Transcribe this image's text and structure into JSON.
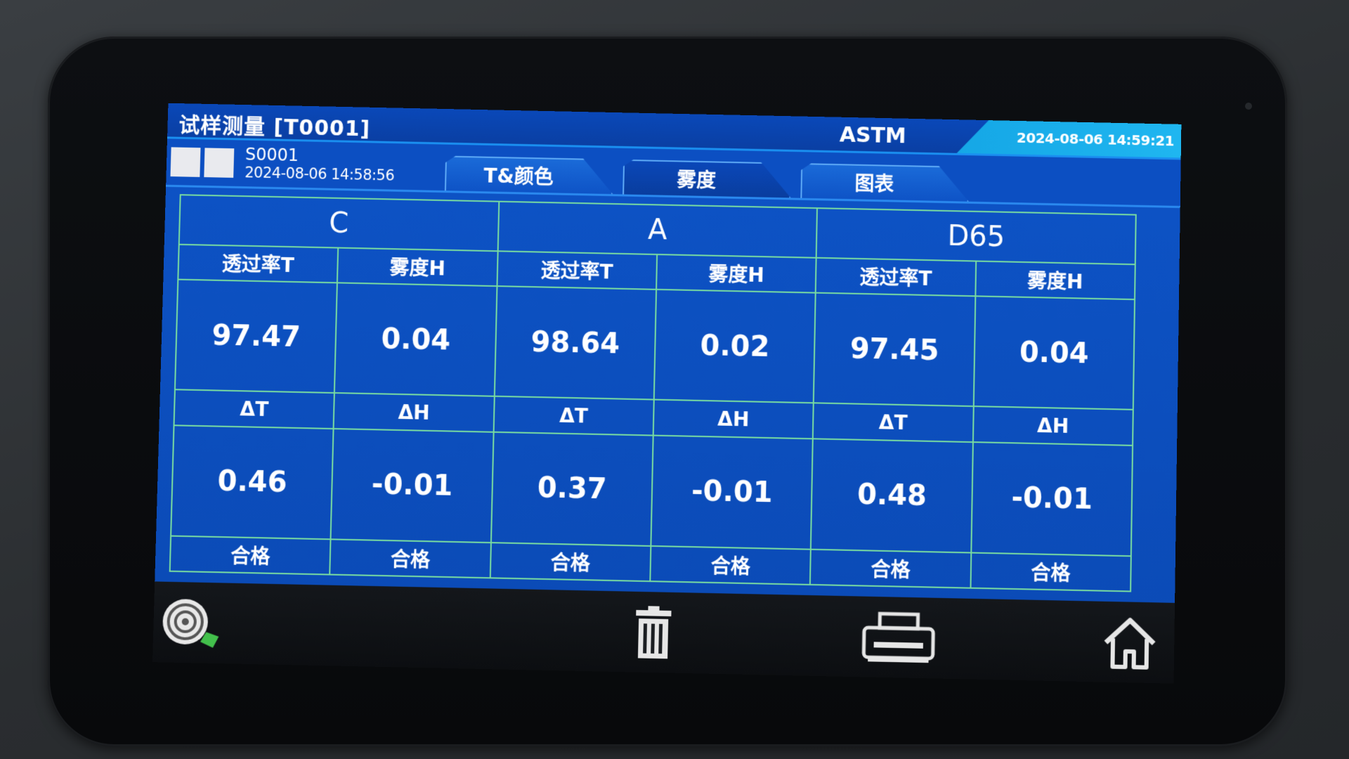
{
  "header": {
    "title": "试样测量 [T0001]",
    "standard": "ASTM",
    "datetime": "2024-08-06 14:59:21"
  },
  "sample": {
    "id": "S0001",
    "time": "2024-08-06 14:58:56"
  },
  "tabs": [
    {
      "label": "T&颜色",
      "active": false
    },
    {
      "label": "雾度",
      "active": true
    },
    {
      "label": "图表",
      "active": false
    }
  ],
  "results": {
    "illuminants": [
      "C",
      "A",
      "D65"
    ],
    "quantity_headers": [
      "透过率T",
      "雾度H"
    ],
    "delta_headers": [
      "ΔT",
      "ΔH"
    ],
    "values": [
      [
        "97.47",
        "0.04"
      ],
      [
        "98.64",
        "0.02"
      ],
      [
        "97.45",
        "0.04"
      ]
    ],
    "deltas": [
      [
        "0.46",
        "-0.01"
      ],
      [
        "0.37",
        "-0.01"
      ],
      [
        "0.48",
        "-0.01"
      ]
    ],
    "status": "合格"
  },
  "colors": {
    "title_bg": "#0a48b8",
    "content_bg": "#0d52c4",
    "grid_line": "#79dca0",
    "pass_green": "#2fe07a",
    "clock_bg": "#1fb6f0"
  },
  "toolbar": {
    "icons": [
      "measure-target-icon",
      "trash-icon",
      "printer-icon",
      "home-icon"
    ]
  }
}
